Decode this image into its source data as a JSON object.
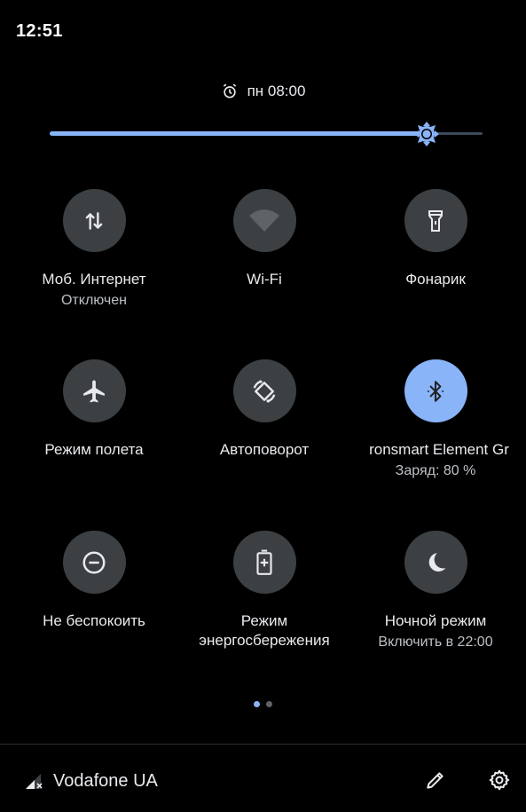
{
  "status_bar": {
    "time": "12:51"
  },
  "alarm": {
    "text": "пн 08:00",
    "icon": "alarm-clock-icon"
  },
  "brightness": {
    "level_percent": 87,
    "icon": "brightness-sun-icon"
  },
  "tiles": [
    {
      "label": "Моб. Интернет",
      "sub": "Отключен",
      "icon": "mobile-data-icon",
      "active": false
    },
    {
      "label": "Wi-Fi",
      "sub": "",
      "icon": "wifi-icon",
      "active": false
    },
    {
      "label": "Фонарик",
      "sub": "",
      "icon": "flashlight-icon",
      "active": false
    },
    {
      "label": "Режим полета",
      "sub": "",
      "icon": "airplane-icon",
      "active": false
    },
    {
      "label": "Автоповорот",
      "sub": "",
      "icon": "auto-rotate-icon",
      "active": false
    },
    {
      "label": "ronsmart Element Gr",
      "sub": "Заряд: 80 %",
      "icon": "bluetooth-icon",
      "active": true
    },
    {
      "label": "Не беспокоить",
      "sub": "",
      "icon": "do-not-disturb-icon",
      "active": false
    },
    {
      "label": "Режим энергосбережения",
      "sub": "",
      "icon": "battery-saver-icon",
      "active": false
    },
    {
      "label": "Ночной режим",
      "sub": "Включить в 22:00",
      "icon": "night-mode-icon",
      "active": false
    }
  ],
  "pager": {
    "pages": 2,
    "current": 1
  },
  "footer": {
    "carrier": "Vodafone UA"
  },
  "colors": {
    "accent": "#8ab4f8",
    "tile_bg": "#3c4043",
    "background": "#000000"
  }
}
